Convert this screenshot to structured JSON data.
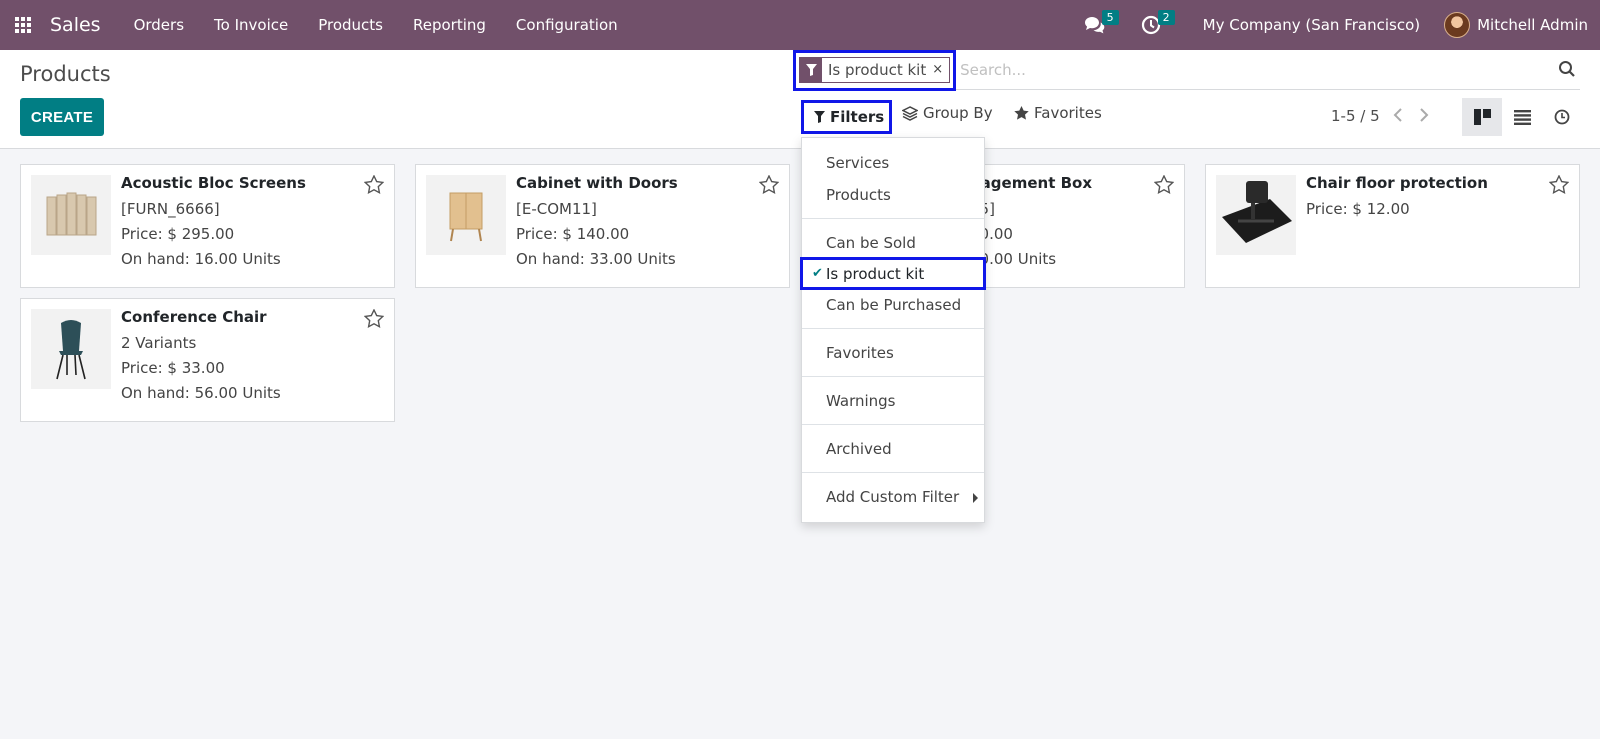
{
  "app": {
    "name": "Sales"
  },
  "navbar": {
    "menus": [
      "Orders",
      "To Invoice",
      "Products",
      "Reporting",
      "Configuration"
    ],
    "messages_count": "5",
    "activities_count": "2",
    "company": "My Company (San Francisco)",
    "user": "Mitchell Admin"
  },
  "control_panel": {
    "title": "Products",
    "create_label": "CREATE",
    "search": {
      "facet": "Is product kit",
      "facet_remove": "×",
      "placeholder": "Search..."
    },
    "filters_label": "Filters",
    "groupby_label": "Group By",
    "favorites_label": "Favorites",
    "pager": "1-5 / 5"
  },
  "products": [
    {
      "name": "Acoustic Bloc Screens",
      "ref": "[FURN_6666]",
      "price": "Price: $ 295.00",
      "onhand": "On hand: 16.00 Units"
    },
    {
      "name": "Cabinet with Doors",
      "ref": "[E-COM11]",
      "price": "Price: $ 140.00",
      "onhand": "On hand: 33.00 Units"
    },
    {
      "name": "nagement Box",
      "ref": "55]",
      "price": "00.00",
      "onhand": "00.00 Units"
    },
    {
      "name": "Chair floor protection",
      "price": "Price: $ 12.00"
    },
    {
      "name": "Conference Chair",
      "ref": "2 Variants",
      "price": "Price: $ 33.00",
      "onhand": "On hand: 56.00 Units"
    }
  ],
  "filters_menu": {
    "items": [
      "Services",
      "Products",
      "Can be Sold",
      "Is product kit",
      "Can be Purchased",
      "Favorites",
      "Warnings",
      "Archived",
      "Add Custom Filter"
    ],
    "checked": "Is product kit"
  },
  "colors": {
    "navbar": "#71506a",
    "primary": "#017e84",
    "highlight": "#1017e8"
  }
}
